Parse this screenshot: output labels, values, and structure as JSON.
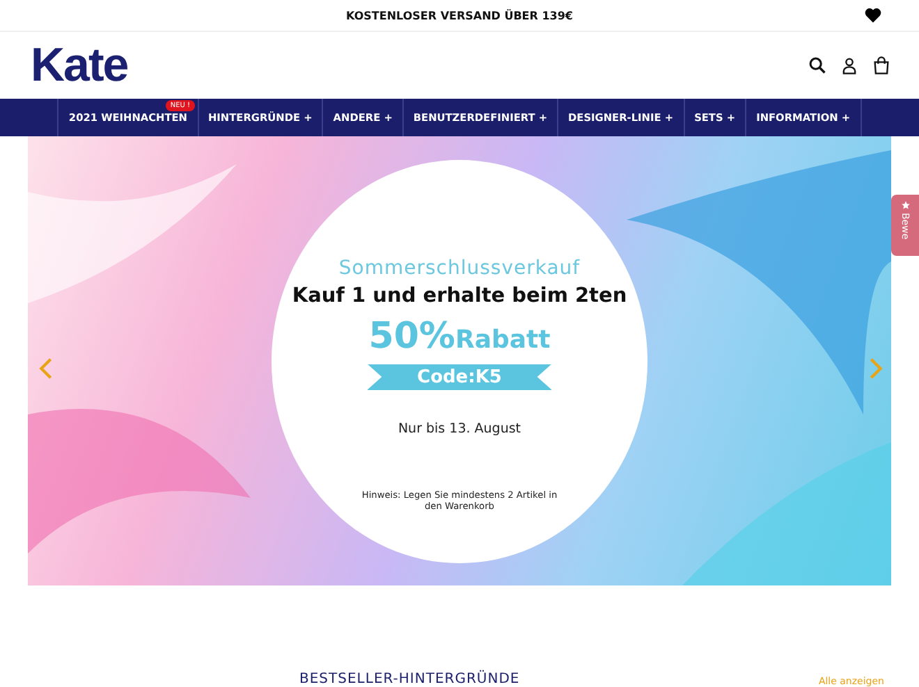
{
  "announcement": "KOSTENLOSER VERSAND ÜBER 139€",
  "logo": "Kate",
  "nav": [
    {
      "label": "2021 WEIHNACHTEN",
      "badge": "NEU !"
    },
    {
      "label": "HINTERGRÜNDE +"
    },
    {
      "label": "ANDERE +"
    },
    {
      "label": "BENUTZERDEFINIERT +"
    },
    {
      "label": "DESIGNER-LINIE +"
    },
    {
      "label": "SETS +"
    },
    {
      "label": "INFORMATION +"
    }
  ],
  "banner": {
    "title": "Sommerschlussverkauf",
    "headline": "Kauf 1 und erhalte beim 2ten",
    "discount": "50%",
    "discount_word": "Rabatt",
    "code": "Code:K5",
    "until": "Nur bis 13. August",
    "note": "Hinweis: Legen Sie mindestens 2 Artikel in den Warenkorb"
  },
  "review_tab": "Bewe",
  "section": {
    "title": "BESTSELLER-HINTERGRÜNDE",
    "link": "Alle anzeigen"
  }
}
